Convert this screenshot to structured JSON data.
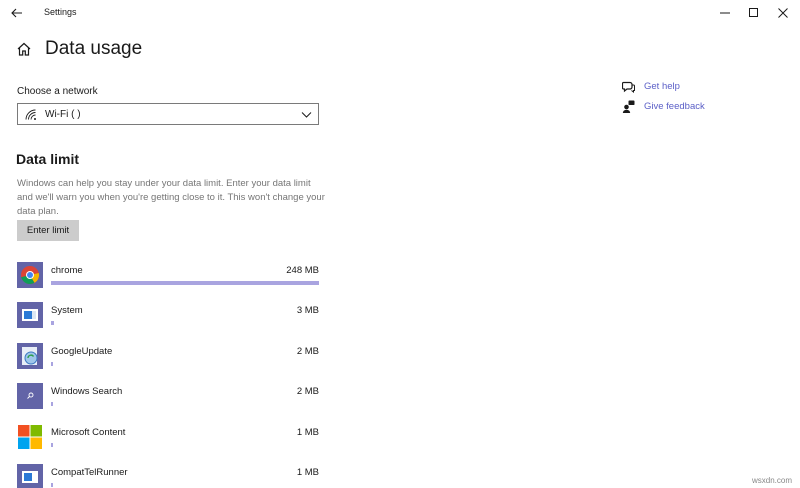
{
  "window": {
    "title": "Settings"
  },
  "page": {
    "title": "Data usage"
  },
  "network": {
    "label": "Choose a network",
    "selected": "Wi-Fi (         )"
  },
  "data_limit": {
    "title": "Data limit",
    "description": "Windows can help you stay under your data limit. Enter your data limit and we'll warn you when you're getting close to it. This won't change your data plan.",
    "button_label": "Enter limit"
  },
  "apps": [
    {
      "name": "chrome",
      "size": "248 MB",
      "usage": 248,
      "icon": "chrome-icon"
    },
    {
      "name": "System",
      "size": "3 MB",
      "usage": 3,
      "icon": "system-icon"
    },
    {
      "name": "GoogleUpdate",
      "size": "2 MB",
      "usage": 2,
      "icon": "google-update-icon"
    },
    {
      "name": "Windows Search",
      "size": "2 MB",
      "usage": 2,
      "icon": "windows-search-icon"
    },
    {
      "name": "Microsoft Content",
      "size": "1 MB",
      "usage": 1,
      "icon": "microsoft-content-icon"
    },
    {
      "name": "CompatTelRunner",
      "size": "1 MB",
      "usage": 1,
      "icon": "compattelrunner-icon"
    }
  ],
  "usage_max": 248,
  "help": {
    "get_help": "Get help",
    "give_feedback": "Give feedback"
  },
  "watermark": "wsxdn.com",
  "colors": {
    "accent": "#5b5fc7",
    "usage_bar": "#a9a4e0",
    "button": "#cccccc",
    "app_tile": "#6264a7"
  }
}
